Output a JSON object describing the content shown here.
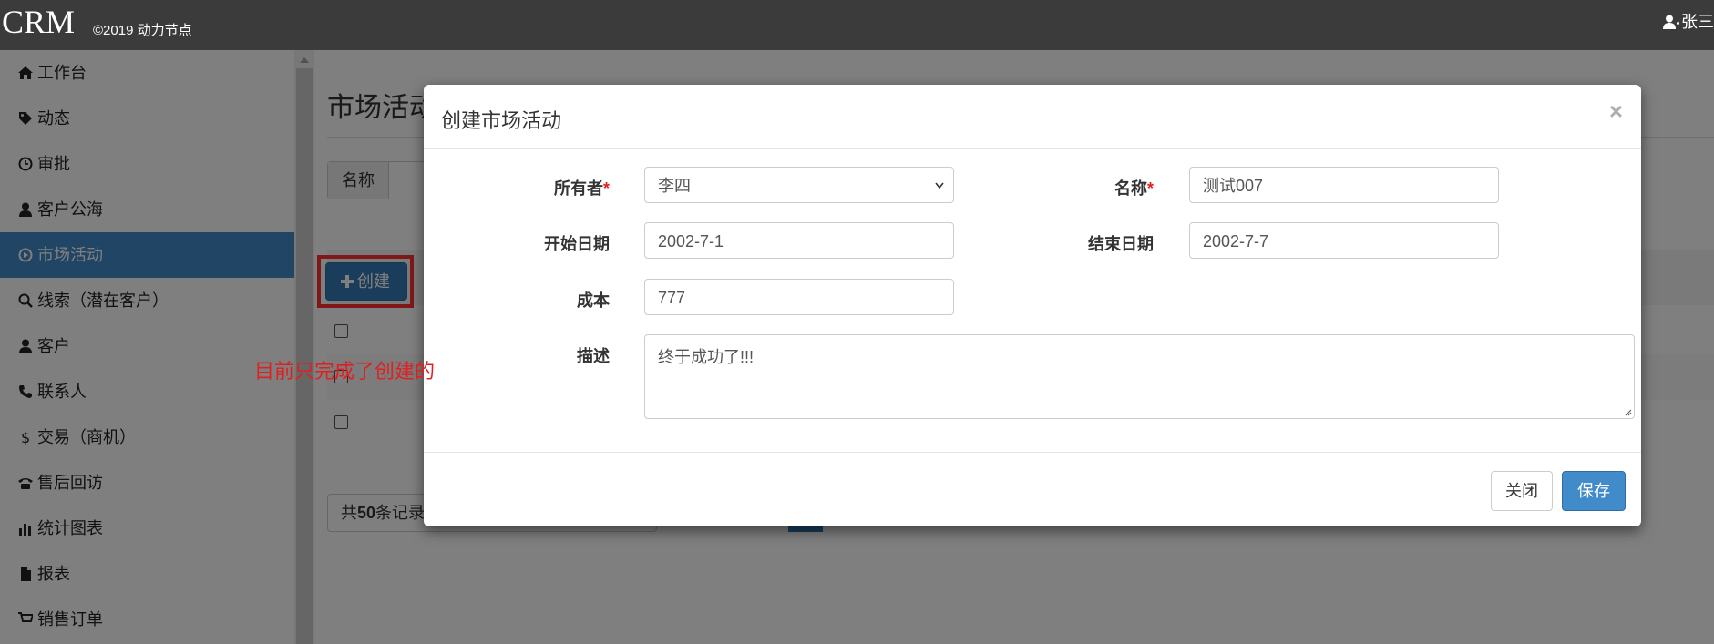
{
  "topbar": {
    "brand": "CRM",
    "copyright": "©2019 动力节点",
    "user_name": "张三"
  },
  "sidebar": {
    "items": [
      {
        "label": "工作台",
        "icon": "home-icon"
      },
      {
        "label": "动态",
        "icon": "tag-icon"
      },
      {
        "label": "审批",
        "icon": "clock-icon"
      },
      {
        "label": "客户公海",
        "icon": "user-icon"
      },
      {
        "label": "市场活动",
        "icon": "play-circle-icon",
        "active": true
      },
      {
        "label": "线索（潜在客户）",
        "icon": "search-icon"
      },
      {
        "label": "客户",
        "icon": "user-icon"
      },
      {
        "label": "联系人",
        "icon": "phone-icon"
      },
      {
        "label": "交易（商机）",
        "icon": "dollar-icon"
      },
      {
        "label": "售后回访",
        "icon": "phone-alt-icon"
      },
      {
        "label": "统计图表",
        "icon": "stats-icon"
      },
      {
        "label": "报表",
        "icon": "file-icon"
      },
      {
        "label": "销售订单",
        "icon": "shopping-cart-icon"
      }
    ]
  },
  "main": {
    "title": "市场活动",
    "search_name_label": "名称",
    "create_button": "创建",
    "pager": {
      "prefix": "共",
      "count": "50",
      "suffix": "条记录"
    }
  },
  "annotation": {
    "text": "目前只完成了创建的"
  },
  "modal": {
    "title": "创建市场活动",
    "close_symbol": "×",
    "fields": {
      "owner_label": "所有者",
      "owner_value": "李四",
      "name_label": "名称",
      "name_value": "测试007",
      "start_label": "开始日期",
      "start_value": "2002-7-1",
      "end_label": "结束日期",
      "end_value": "2002-7-7",
      "cost_label": "成本",
      "cost_value": "777",
      "desc_label": "描述",
      "desc_value": "终于成功了!!!",
      "required_mark": "*"
    },
    "close_button": "关闭",
    "save_button": "保存"
  },
  "colors": {
    "topbar": "#3b3b3b",
    "active_nav": "#428bca",
    "primary_button": "#337ab7",
    "annotation": "#e02020"
  }
}
